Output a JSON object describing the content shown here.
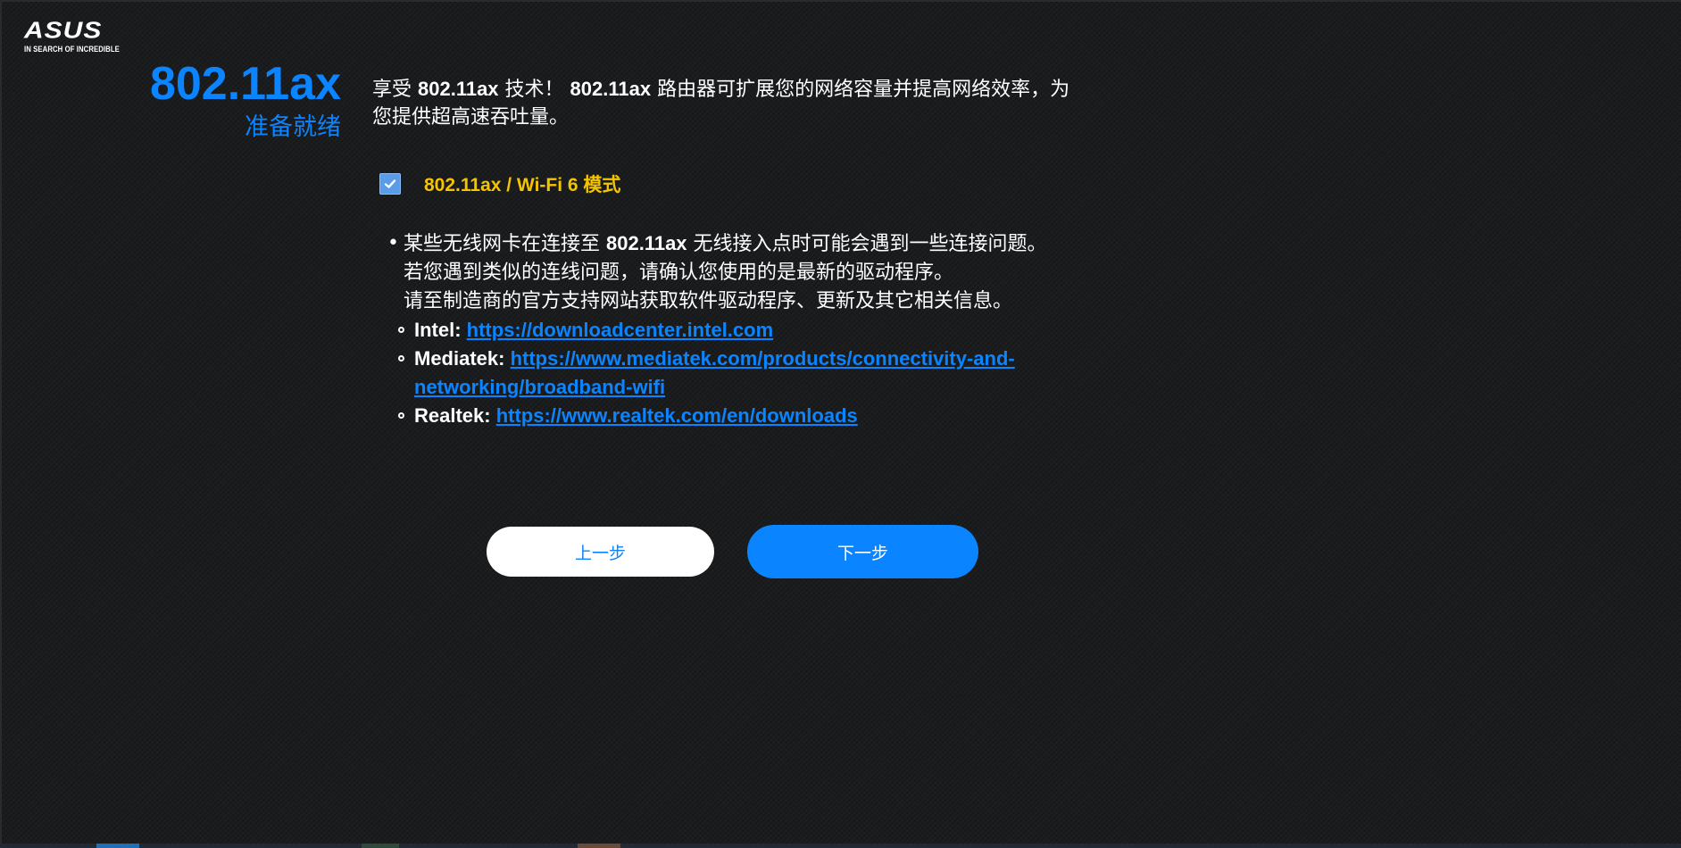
{
  "brand": {
    "logo_text": "ASUS",
    "tagline": "IN SEARCH OF INCREDIBLE"
  },
  "header": {
    "title": "802.11ax",
    "subtitle": "准备就绪"
  },
  "intro": {
    "part1": "享受 ",
    "bold1": "802.11ax",
    "part2": " 技术！ ",
    "bold2": "802.11ax",
    "part3": " 路由器可扩展您的网络容量并提高网络效率，为您提供超高速吞吐量。"
  },
  "option": {
    "label": "802.11ax / Wi-Fi 6 模式",
    "checked": true
  },
  "notes": {
    "bullet": "•",
    "line1_a": "某些无线网卡在连接至 ",
    "line1_bold": "802.11ax",
    "line1_b": " 无线接入点时可能会遇到一些连接问题。",
    "line2": "若您遇到类似的连线问题，请确认您使用的是最新的驱动程序。",
    "line3": "请至制造商的官方支持网站获取软件驱动程序、更新及其它相关信息。",
    "vendors": [
      {
        "name": "Intel: ",
        "url": "https://downloadcenter.intel.com"
      },
      {
        "name": "Mediatek: ",
        "url": "https://www.mediatek.com/products/connectivity-and-networking/broadband-wifi"
      },
      {
        "name": "Realtek: ",
        "url": "https://www.realtek.com/en/downloads"
      }
    ]
  },
  "buttons": {
    "prev": "上一步",
    "next": "下一步"
  },
  "colors": {
    "accent": "#0a84ff",
    "option_label": "#f5c400",
    "background": "#1b1c1e"
  },
  "icons": {
    "checkbox": "check-icon",
    "sub_bullet": "hollow-circle-bullet-icon"
  }
}
